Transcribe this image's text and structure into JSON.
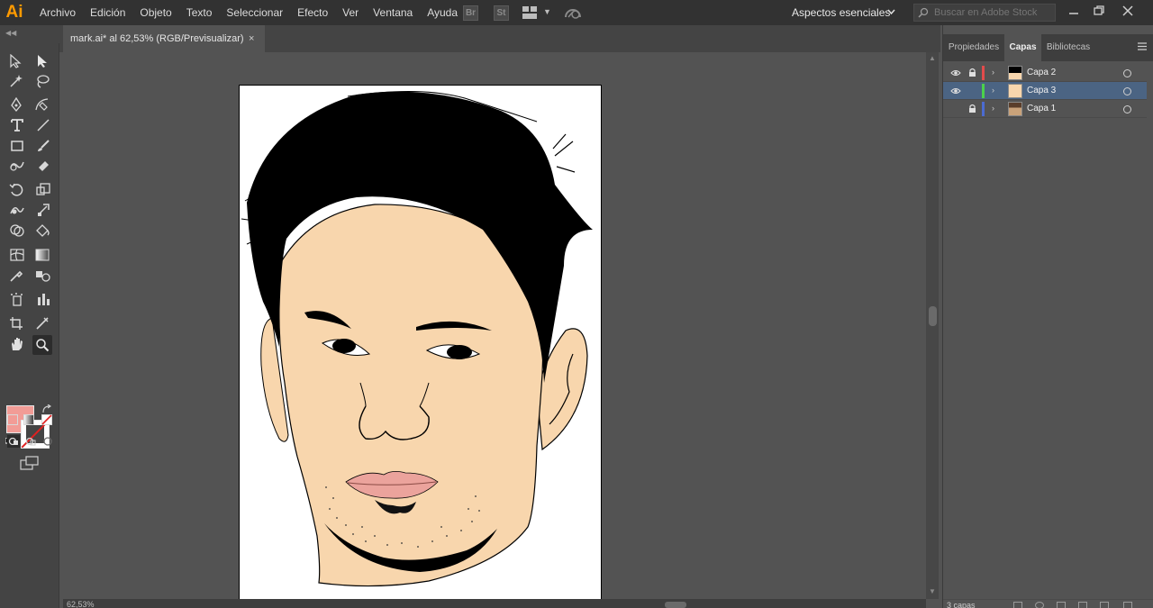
{
  "app": {
    "logo": "Ai"
  },
  "menu": [
    "Archivo",
    "Edición",
    "Objeto",
    "Texto",
    "Seleccionar",
    "Efecto",
    "Ver",
    "Ventana",
    "Ayuda"
  ],
  "appbar": {
    "bridge_label": "Br",
    "stock_label": "St",
    "workspace": "Aspectos esenciales",
    "search_placeholder": "Buscar en Adobe Stock"
  },
  "document": {
    "tab_title": "mark.ai* al 62,53% (RGB/Previsualizar)",
    "close_glyph": "×"
  },
  "tools": {
    "fill_color": "#f29c96",
    "stroke": "none"
  },
  "panels": {
    "tabs": [
      "Propiedades",
      "Capas",
      "Bibliotecas"
    ],
    "active_tab": "Capas",
    "layers": [
      {
        "name": "Capa 2",
        "visible": true,
        "locked": true,
        "color": "#e24b4b",
        "selected": false
      },
      {
        "name": "Capa 3",
        "visible": true,
        "locked": false,
        "color": "#4bd14b",
        "selected": true
      },
      {
        "name": "Capa 1",
        "visible": false,
        "locked": true,
        "color": "#4b6bd1",
        "selected": false
      }
    ],
    "layer_count": "3 capas"
  },
  "status": {
    "zoom": "62,53%"
  },
  "colors": {
    "skin": "#f8d6ad",
    "lips": "#eba39c",
    "hair": "#000000",
    "selection": "#4b6483"
  }
}
